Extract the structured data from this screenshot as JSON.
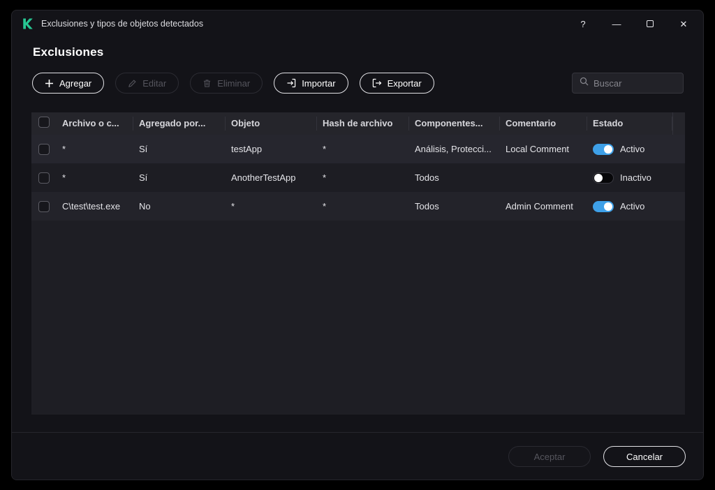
{
  "window": {
    "title": "Exclusiones y tipos de objetos detectados",
    "controls": {
      "help": "?",
      "minimize": "—",
      "close": "✕"
    }
  },
  "page": {
    "title": "Exclusiones"
  },
  "toolbar": {
    "add": "Agregar",
    "edit": "Editar",
    "delete": "Eliminar",
    "import": "Importar",
    "export": "Exportar",
    "search_placeholder": "Buscar"
  },
  "table": {
    "headers": [
      "Archivo o c...",
      "Agregado por...",
      "Objeto",
      "Hash de archivo",
      "Componentes...",
      "Comentario",
      "Estado"
    ],
    "rows": [
      {
        "file": "*",
        "added": "Sí",
        "object": "testApp",
        "hash": "*",
        "components": "Análisis, Protecci...",
        "comment": "Local Comment",
        "state": "Activo",
        "active": true
      },
      {
        "file": "*",
        "added": "Sí",
        "object": "AnotherTestApp",
        "hash": "*",
        "components": "Todos",
        "comment": "",
        "state": "Inactivo",
        "active": false
      },
      {
        "file": "C\\test\\test.exe",
        "added": "No",
        "object": "*",
        "hash": "*",
        "components": "Todos",
        "comment": "Admin Comment",
        "state": "Activo",
        "active": true
      }
    ]
  },
  "footer": {
    "accept": "Aceptar",
    "cancel": "Cancelar"
  },
  "colors": {
    "brand_green": "#27c793",
    "toggle_active": "#3ea0e8"
  }
}
